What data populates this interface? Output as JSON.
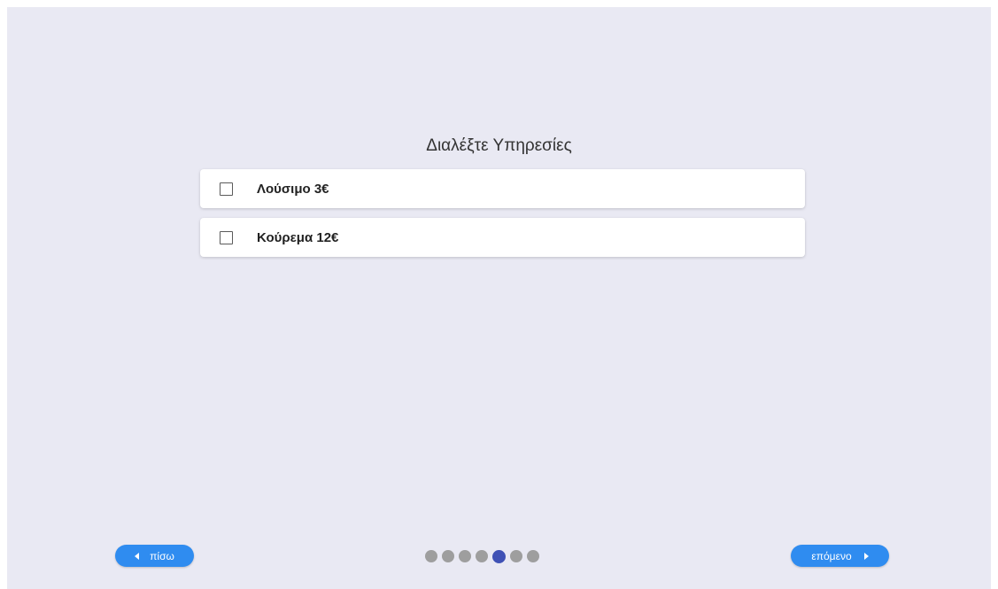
{
  "page": {
    "title": "Διαλέξτε Υπηρεσίες"
  },
  "services": [
    {
      "label": "Λούσιμο  3€",
      "checked": false
    },
    {
      "label": "Κούρεμα  12€",
      "checked": false
    }
  ],
  "navigation": {
    "back_label": "πίσω",
    "next_label": "επόμενο",
    "steps_total": 7,
    "current_step": 5
  },
  "colors": {
    "background": "#e9e9f3",
    "button": "#2f8cf0",
    "dot_inactive": "#9e9e9e",
    "dot_active": "#3f51b5"
  },
  "icons": {
    "back": "caret-left-icon",
    "next": "caret-right-icon",
    "checkbox": "checkbox-unchecked"
  }
}
